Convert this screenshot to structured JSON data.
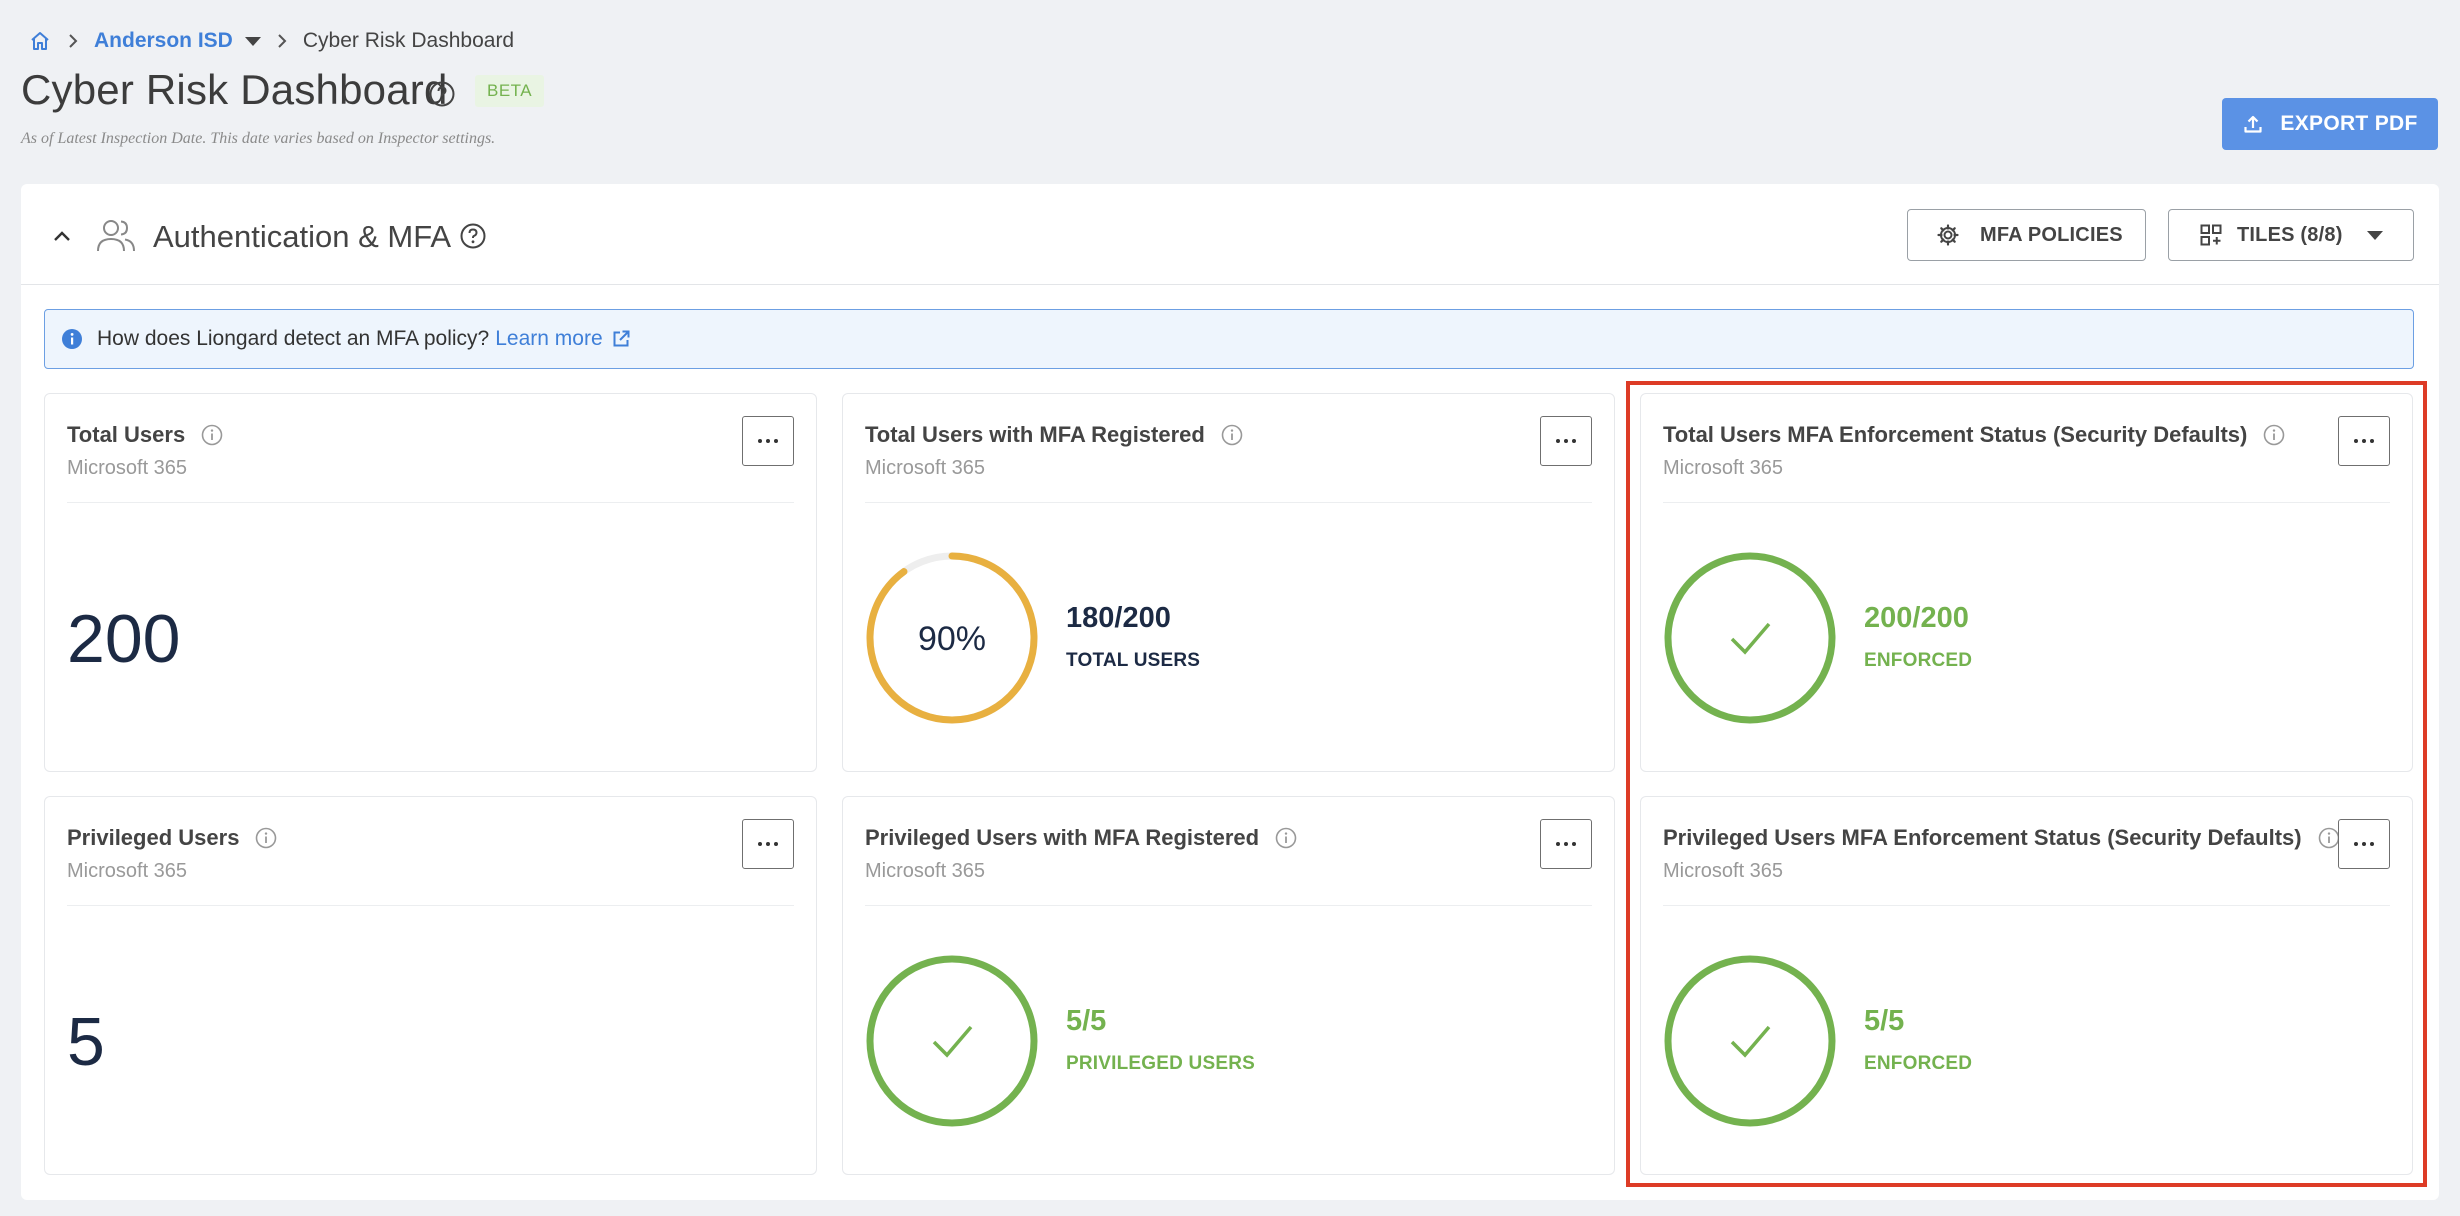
{
  "breadcrumb": {
    "org": "Anderson ISD",
    "current": "Cyber Risk Dashboard"
  },
  "page": {
    "title": "Cyber Risk Dashboard",
    "badge": "BETA",
    "subtitle": "As of Latest Inspection Date. This date varies based on Inspector settings.",
    "export_label": "EXPORT PDF"
  },
  "section": {
    "title": "Authentication & MFA",
    "mfa_policies_label": "MFA POLICIES",
    "tiles_label": "TILES (8/8)",
    "info_text": "How does Liongard detect an MFA policy?",
    "learn_more": "Learn more"
  },
  "cards": [
    {
      "title": "Total Users",
      "source": "Microsoft 365",
      "value": "200"
    },
    {
      "title": "Total Users with MFA Registered",
      "source": "Microsoft 365",
      "percent": "90%",
      "progress": 0.9,
      "stat": "180/200",
      "stat_label": "TOTAL USERS"
    },
    {
      "title": "Total Users MFA Enforcement Status (Security Defaults)",
      "source": "Microsoft 365",
      "stat": "200/200",
      "stat_label": "ENFORCED"
    },
    {
      "title": "Privileged Users",
      "source": "Microsoft 365",
      "value": "5"
    },
    {
      "title": "Privileged Users with MFA Registered",
      "source": "Microsoft 365",
      "stat": "5/5",
      "stat_label": "PRIVILEGED USERS"
    },
    {
      "title": "Privileged Users MFA Enforcement Status (Security Defaults)",
      "source": "Microsoft 365",
      "stat": "5/5",
      "stat_label": "ENFORCED"
    }
  ],
  "colors": {
    "accent": "#5b92e5",
    "success": "#74b24f",
    "warning": "#e8b040",
    "highlight": "#dd3b26"
  }
}
